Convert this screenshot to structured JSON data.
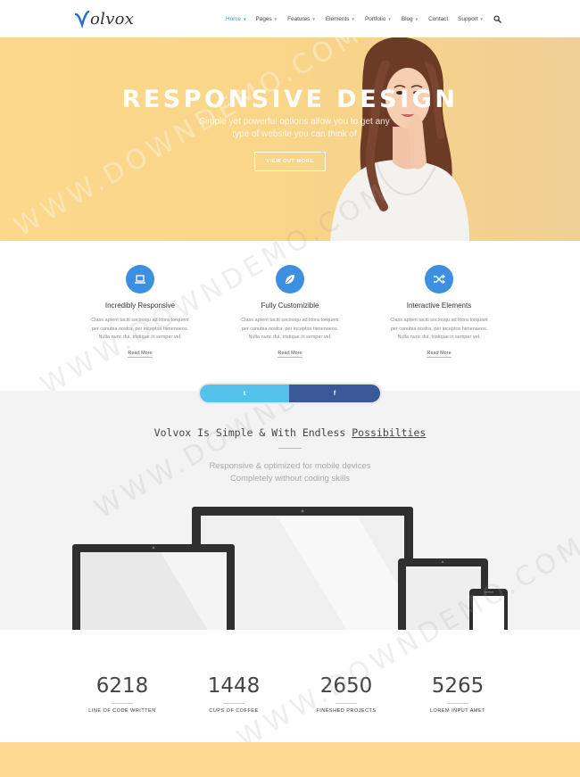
{
  "header": {
    "logo_text": "olvox",
    "nav": [
      {
        "label": "Home",
        "dropdown": true,
        "active": true
      },
      {
        "label": "Pages",
        "dropdown": true
      },
      {
        "label": "Features",
        "dropdown": true
      },
      {
        "label": "Elements",
        "dropdown": true
      },
      {
        "label": "Portfolio",
        "dropdown": true
      },
      {
        "label": "Blog",
        "dropdown": true
      },
      {
        "label": "Contact",
        "dropdown": false
      },
      {
        "label": "Support",
        "dropdown": true
      }
    ],
    "search_icon": "search-icon"
  },
  "hero": {
    "title": "RESPONSIVE DESIGN",
    "subtitle_line1": "Simple yet powerful options allow you to get any",
    "subtitle_line2": "type of website you can think of",
    "button": "VIEW OUT MORE"
  },
  "features": [
    {
      "icon": "laptop-icon",
      "title": "Incredibly Responsive",
      "text": [
        "Class aptent taciti sociosqu ad litora torquent",
        "per conubia nostra, per inceptos himenaeos.",
        "Nulla nunc dui, tristique in semper vel."
      ],
      "link": "Read More"
    },
    {
      "icon": "leaf-icon",
      "title": "Fully Customizible",
      "text": [
        "Class aptent taciti sociosqu ad litora torquent",
        "per conubia nostra, per inceptos himenaeos.",
        "Nulla nunc dui, tristique in semper vel."
      ],
      "link": "Read More"
    },
    {
      "icon": "shuffle-icon",
      "title": "Interactive Elements",
      "text": [
        "Class aptent taciti sociosqu ad litora torquent",
        "per conubia nostra, per inceptos himenaeos.",
        "Nulla nunc dui, tristique in semper vel."
      ],
      "link": "Read More"
    }
  ],
  "share": {
    "twitter_glyph": "t",
    "facebook_glyph": "f"
  },
  "simple": {
    "title_plain": "Volvox Is Simple & With Endless ",
    "title_underlined": "Possibilties",
    "sub_line1": "Responsive & optimized for mobile devices",
    "sub_line2": "Completely without coding skills"
  },
  "stats": [
    {
      "number": "6218",
      "label": "LINE OF CODE WRITTEN"
    },
    {
      "number": "1448",
      "label": "CUPS OF COFFEE"
    },
    {
      "number": "2650",
      "label": "FINESHED PROJECTS"
    },
    {
      "number": "5265",
      "label": "LOREM INPUT AMET"
    }
  ],
  "watermark": "WWW.DOWNDEMO.COM",
  "colors": {
    "accent": "#3a9ad9",
    "icon_blue": "#3d8fe0",
    "hero_yellow": "#fbd88c",
    "twitter": "#55c2ec",
    "facebook": "#3b5998"
  }
}
